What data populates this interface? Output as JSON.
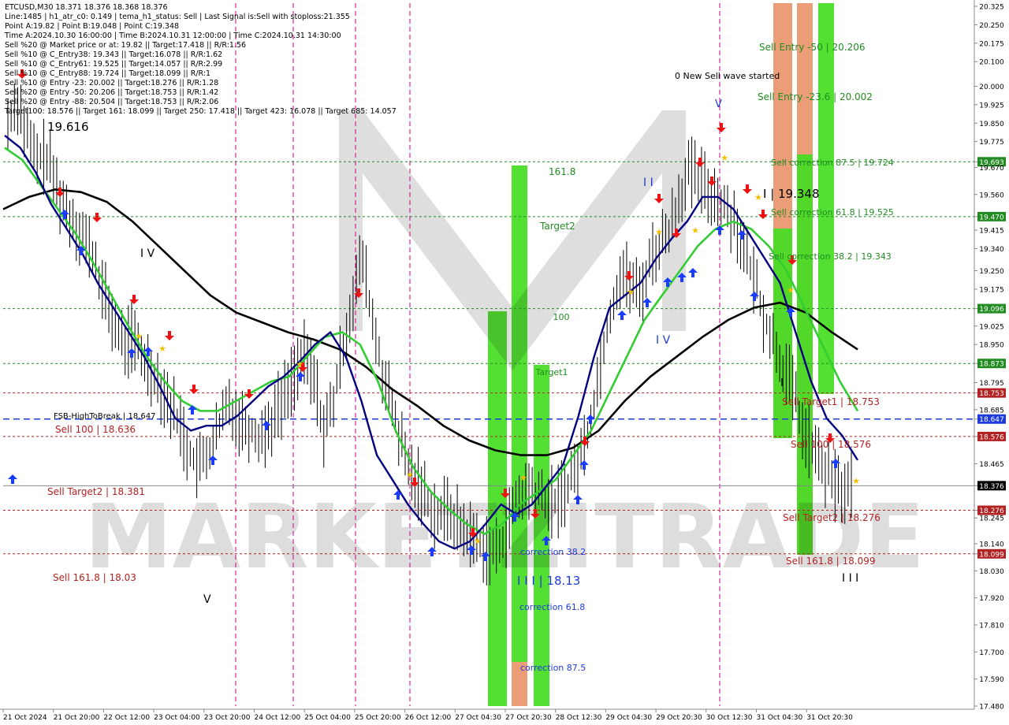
{
  "header": {
    "lines": [
      "ETCUSD,M30  18.371 18.376 18.368 18.376",
      "Line:1485  |  h1_atr_c0: 0.149  |  tema_h1_status: Sell  |  Last Signal is:Sell with stoploss:21.355",
      "Point A:19.82  |  Point B:19.048  |  Point C:19.348",
      "Time A:2024.10.30 16:00:00  |  Time B:2024.10.31 12:00:00  |  Time C:2024.10.31 14:30:00",
      "Sell %20 @ Market price or at: 19.82  ||  Target:17.418  ||  R/R:1.56",
      "Sell %10 @ C_Entry38: 19.343  ||  Target:16.078  ||  R/R:1.62",
      "Sell %10 @ C_Entry61: 19.525  ||  Target:14.057  ||  R/R:2.99",
      "Sell %10 @ C_Entry88: 19.724  ||  Target:18.099  ||  R/R:1",
      "Sell %10 @ Entry -23: 20.002  ||  Target:18.276  ||  R/R:1.28",
      "Sell %20 @ Entry -50: 20.206  ||  Target:18.753  ||  R/R:1.42",
      "Sell %20 @ Entry -88: 20.504  ||  Target:18.753  ||  R/R:2.06",
      "Target100: 18.576  ||  Target 161: 18.099  ||  Target 250: 17.418  ||  Target 423: 16.078  ||  Target 685: 14.057"
    ]
  },
  "watermark": "MARKETZITRADE",
  "colors": {
    "background": "#ffffff",
    "candle": "#000000",
    "ma_fast": "#000080",
    "ma_mid": "#32cd32",
    "ma_slow": "#000000",
    "green_level": "#228b22",
    "red_level": "#b22222",
    "blue_level": "#1e3cdc",
    "zone_green": "#44dd22",
    "zone_orange": "#e8956a",
    "vline": "#cc0088",
    "arrow_up": "#1a3cff",
    "arrow_down": "#ee1111",
    "star": "#f0c000"
  },
  "chart_data": {
    "type": "candlestick",
    "symbol": "ETCUSD",
    "timeframe": "M30",
    "last_price": 18.376,
    "ylim": [
      17.48,
      20.325
    ],
    "y_ticks": [
      "20.325",
      "20.250",
      "20.175",
      "20.100",
      "20.000",
      "19.925",
      "19.850",
      "19.775",
      "19.693",
      "19.670",
      "19.560",
      "19.470",
      "19.415",
      "19.340",
      "19.250",
      "19.175",
      "19.096",
      "19.025",
      "18.950",
      "18.873",
      "18.795",
      "18.753",
      "18.685",
      "18.647",
      "18.576",
      "18.465",
      "18.376",
      "18.276",
      "18.245",
      "18.140",
      "18.099",
      "18.030",
      "17.920",
      "17.810",
      "17.700",
      "17.590",
      "17.480"
    ],
    "x_labels": [
      "21 Oct 2024",
      "21 Oct 20:00",
      "22 Oct 12:00",
      "23 Oct 04:00",
      "23 Oct 20:00",
      "24 Oct 12:00",
      "25 Oct 04:00",
      "25 Oct 20:00",
      "26 Oct 12:00",
      "27 Oct 04:30",
      "27 Oct 20:30",
      "28 Oct 12:30",
      "29 Oct 04:30",
      "29 Oct 20:30",
      "30 Oct 12:30",
      "31 Oct 04:30",
      "31 Oct 20:30"
    ],
    "price_path": [
      19.85,
      19.95,
      19.8,
      19.7,
      19.72,
      19.6,
      19.5,
      19.45,
      19.38,
      19.3,
      19.15,
      19.05,
      18.95,
      18.98,
      18.9,
      18.85,
      18.78,
      18.7,
      18.62,
      18.5,
      18.45,
      18.52,
      18.6,
      18.72,
      18.65,
      18.62,
      18.58,
      18.6,
      18.68,
      18.75,
      18.85,
      18.9,
      18.8,
      18.6,
      18.72,
      18.95,
      19.15,
      19.3,
      19.05,
      18.85,
      18.7,
      18.55,
      18.42,
      18.38,
      18.3,
      18.25,
      18.28,
      18.22,
      18.18,
      18.15,
      18.12,
      18.1,
      18.2,
      18.3,
      18.36,
      18.35,
      18.32,
      18.3,
      18.35,
      18.42,
      18.52,
      18.68,
      18.92,
      19.1,
      19.25,
      19.2,
      19.15,
      19.3,
      19.35,
      19.42,
      19.55,
      19.65,
      19.62,
      19.58,
      19.55,
      19.5,
      19.45,
      19.3,
      19.2,
      19.05,
      18.95,
      18.85,
      18.75,
      18.6,
      18.52,
      18.45,
      18.4,
      18.35,
      18.376
    ],
    "ma_fast": [
      19.8,
      19.75,
      19.65,
      19.52,
      19.42,
      19.32,
      19.2,
      19.1,
      19.0,
      18.9,
      18.78,
      18.65,
      18.6,
      18.62,
      18.62,
      18.66,
      18.72,
      18.78,
      18.82,
      18.88,
      18.95,
      19.0,
      18.9,
      18.72,
      18.5,
      18.4,
      18.3,
      18.22,
      18.15,
      18.12,
      18.15,
      18.22,
      18.3,
      18.26,
      18.3,
      18.38,
      18.46,
      18.66,
      18.9,
      19.1,
      19.15,
      19.2,
      19.3,
      19.38,
      19.45,
      19.55,
      19.55,
      19.5,
      19.4,
      19.3,
      19.2,
      19.0,
      18.8,
      18.65,
      18.58,
      18.48
    ],
    "ma_mid": [
      19.75,
      19.7,
      19.6,
      19.5,
      19.4,
      19.28,
      19.15,
      19.02,
      18.9,
      18.8,
      18.72,
      18.68,
      18.68,
      18.72,
      18.76,
      18.8,
      18.82,
      18.9,
      18.98,
      19.0,
      18.95,
      18.8,
      18.6,
      18.45,
      18.35,
      18.28,
      18.22,
      18.18,
      18.22,
      18.3,
      18.35,
      18.4,
      18.5,
      18.6,
      18.75,
      18.9,
      19.05,
      19.15,
      19.25,
      19.35,
      19.42,
      19.45,
      19.42,
      19.35,
      19.25,
      19.1,
      18.95,
      18.8,
      18.68
    ],
    "ma_slow": [
      19.5,
      19.55,
      19.58,
      19.57,
      19.53,
      19.45,
      19.35,
      19.25,
      19.15,
      19.08,
      19.04,
      19.0,
      18.97,
      18.93,
      18.86,
      18.77,
      18.7,
      18.62,
      18.56,
      18.52,
      18.5,
      18.5,
      18.53,
      18.6,
      18.72,
      18.82,
      18.9,
      18.98,
      19.05,
      19.1,
      19.12,
      19.08,
      19.0,
      18.93
    ],
    "levels": [
      {
        "price": 19.693,
        "label": "Sell correction 87.5 | 19.724",
        "axis_label": "19.693",
        "color": "green"
      },
      {
        "price": 19.47,
        "label": "Sell correction 61.8 | 19.525",
        "axis_label": "19.470",
        "color": "green"
      },
      {
        "price": 19.096,
        "label": "100",
        "axis_label": "19.096",
        "color": "green"
      },
      {
        "price": 18.873,
        "label": "Target1",
        "axis_label": "18.873",
        "color": "green"
      },
      {
        "price": 18.753,
        "label": "Sell Target1 | 18.753",
        "axis_label": "18.753",
        "color": "red"
      },
      {
        "price": 18.647,
        "label": "FSB-HighToBreak | 18.647",
        "axis_label": "18.647",
        "color": "blue"
      },
      {
        "price": 18.576,
        "label": "Sell 100 | 18.576",
        "axis_label": "18.576",
        "color": "red"
      },
      {
        "price": 18.376,
        "label": "",
        "axis_label": "18.376",
        "color": "current"
      },
      {
        "price": 18.276,
        "label": "Sell Target2 | 18.276",
        "axis_label": "18.276",
        "color": "red"
      },
      {
        "price": 18.099,
        "label": "Sell 161.8 | 18.099",
        "axis_label": "18.099",
        "color": "red"
      }
    ],
    "text_annotations": [
      {
        "text": "19.616",
        "at": "upper-left"
      },
      {
        "text": "Sell 100 | 18.636",
        "at": "left"
      },
      {
        "text": "Sell Target2 | 18.381",
        "at": "left"
      },
      {
        "text": "Sell 161.8 | 18.03",
        "at": "left"
      },
      {
        "text": "I V",
        "at": "left"
      },
      {
        "text": "V",
        "at": "left"
      },
      {
        "text": "161.8",
        "at": "middle"
      },
      {
        "text": "Target2",
        "at": "middle"
      },
      {
        "text": "correction 38.2",
        "at": "middle"
      },
      {
        "text": "I I I | 18.13",
        "at": "middle"
      },
      {
        "text": "correction 61.8",
        "at": "middle"
      },
      {
        "text": "correction 87.5",
        "at": "middle"
      },
      {
        "text": "I I",
        "at": "middle"
      },
      {
        "text": "I V",
        "at": "middle"
      },
      {
        "text": "0 New Sell wave started",
        "at": "upper-right"
      },
      {
        "text": "V",
        "at": "upper-right"
      },
      {
        "text": "I | 19.348",
        "at": "right"
      },
      {
        "text": "Sell Entry -50 | 20.206",
        "at": "upper-right"
      },
      {
        "text": "Sell Entry -23.6 | 20.002",
        "at": "upper-right"
      },
      {
        "text": "Sell correction 38.2 | 19.343",
        "at": "right"
      },
      {
        "text": "I",
        "at": "right"
      },
      {
        "text": "I I I",
        "at": "lower-right"
      }
    ]
  }
}
